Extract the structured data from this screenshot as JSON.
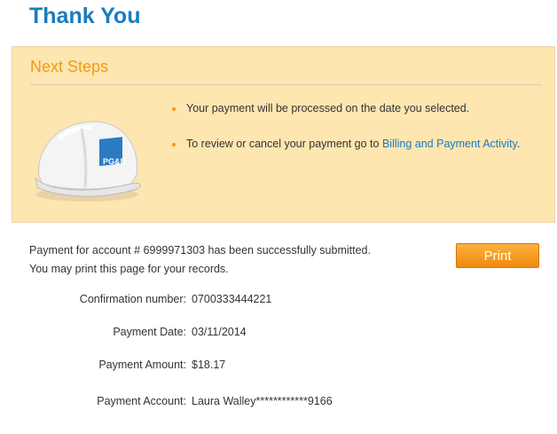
{
  "page": {
    "title": "Thank You"
  },
  "next_steps": {
    "heading": "Next Steps",
    "items": [
      {
        "text": "Your payment will be processed on the date you selected.",
        "link": ""
      },
      {
        "text": "To review or cancel your payment go to ",
        "link": "Billing and Payment Activity",
        "after": "."
      }
    ],
    "logo_text": "PG&E"
  },
  "confirmation": {
    "line1": "Payment for account # 6999971303 has been successfully submitted.",
    "line2": "You may print this page for your records.",
    "print_label": "Print"
  },
  "details": [
    {
      "label": "Confirmation number:",
      "value": "0700333444221"
    },
    {
      "label": "Payment Date:",
      "value": "03/11/2014"
    },
    {
      "label": "Payment Amount:",
      "value": "$18.17"
    },
    {
      "label": "Payment Account:",
      "value": "Laura Walley************9166"
    }
  ],
  "colors": {
    "title_blue": "#1a7bbf",
    "accent_orange": "#f39a12",
    "panel_bg": "#fde6b0"
  },
  "icons": [
    "hard-hat-icon",
    "bullet-icon"
  ]
}
